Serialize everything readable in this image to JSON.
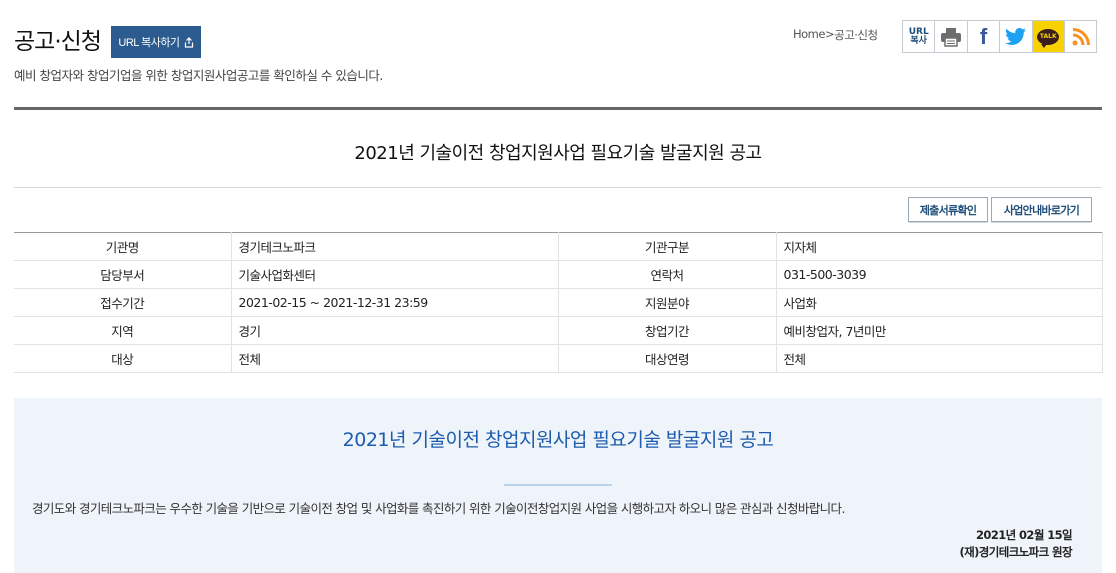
{
  "header": {
    "title": "공고·신청",
    "url_copy_label": "URL 복사하기",
    "subtitle": "예비 창업자와 창업기업을 위한 창업지원사업공고를 확인하실 수 있습니다."
  },
  "breadcrumb": {
    "home": "Home",
    "separator": ">",
    "current": "공고·신청"
  },
  "share": {
    "url_line1": "URL",
    "url_line2": "복사",
    "facebook": "f",
    "kakao": "TALK",
    "kakao_color": "#f7d200",
    "facebook_color": "#3b5998",
    "twitter_color": "#1da1f2",
    "rss_color": "#f7931e"
  },
  "notice": {
    "title": "2021년 기술이전 창업지원사업 필요기술 발굴지원 공고"
  },
  "actions": {
    "docs_label": "제출서류확인",
    "info_label": "사업안내바로가기"
  },
  "info_table": {
    "rows": [
      {
        "label1": "기관명",
        "value1": "경기테크노파크",
        "label2": "기관구분",
        "value2": "지자체"
      },
      {
        "label1": "담당부서",
        "value1": "기술사업화센터",
        "label2": "연락처",
        "value2": "031-500-3039"
      },
      {
        "label1": "접수기간",
        "value1": "2021-02-15 ~ 2021-12-31 23:59",
        "label2": "지원분야",
        "value2": "사업화"
      },
      {
        "label1": "지역",
        "value1": "경기",
        "label2": "창업기간",
        "value2": "예비창업자, 7년미만"
      },
      {
        "label1": "대상",
        "value1": "전체",
        "label2": "대상연령",
        "value2": "전체"
      }
    ]
  },
  "content": {
    "title": "2021년 기술이전 창업지원사업 필요기술 발굴지원 공고",
    "body": "경기도와 경기테크노파크는 우수한 기술을 기반으로 기술이전 창업 및 사업화를 촉진하기 위한 기술이전창업지원 사업을 시행하고자 하오니 많은 관심과 신청바랍니다.",
    "date": "2021년 02월 15일",
    "signature": "(재)경기테크노파크 원장",
    "title_color": "#1d5bad",
    "background": "#eef4fa"
  },
  "theme": {
    "primary": "#2c5c8f"
  }
}
